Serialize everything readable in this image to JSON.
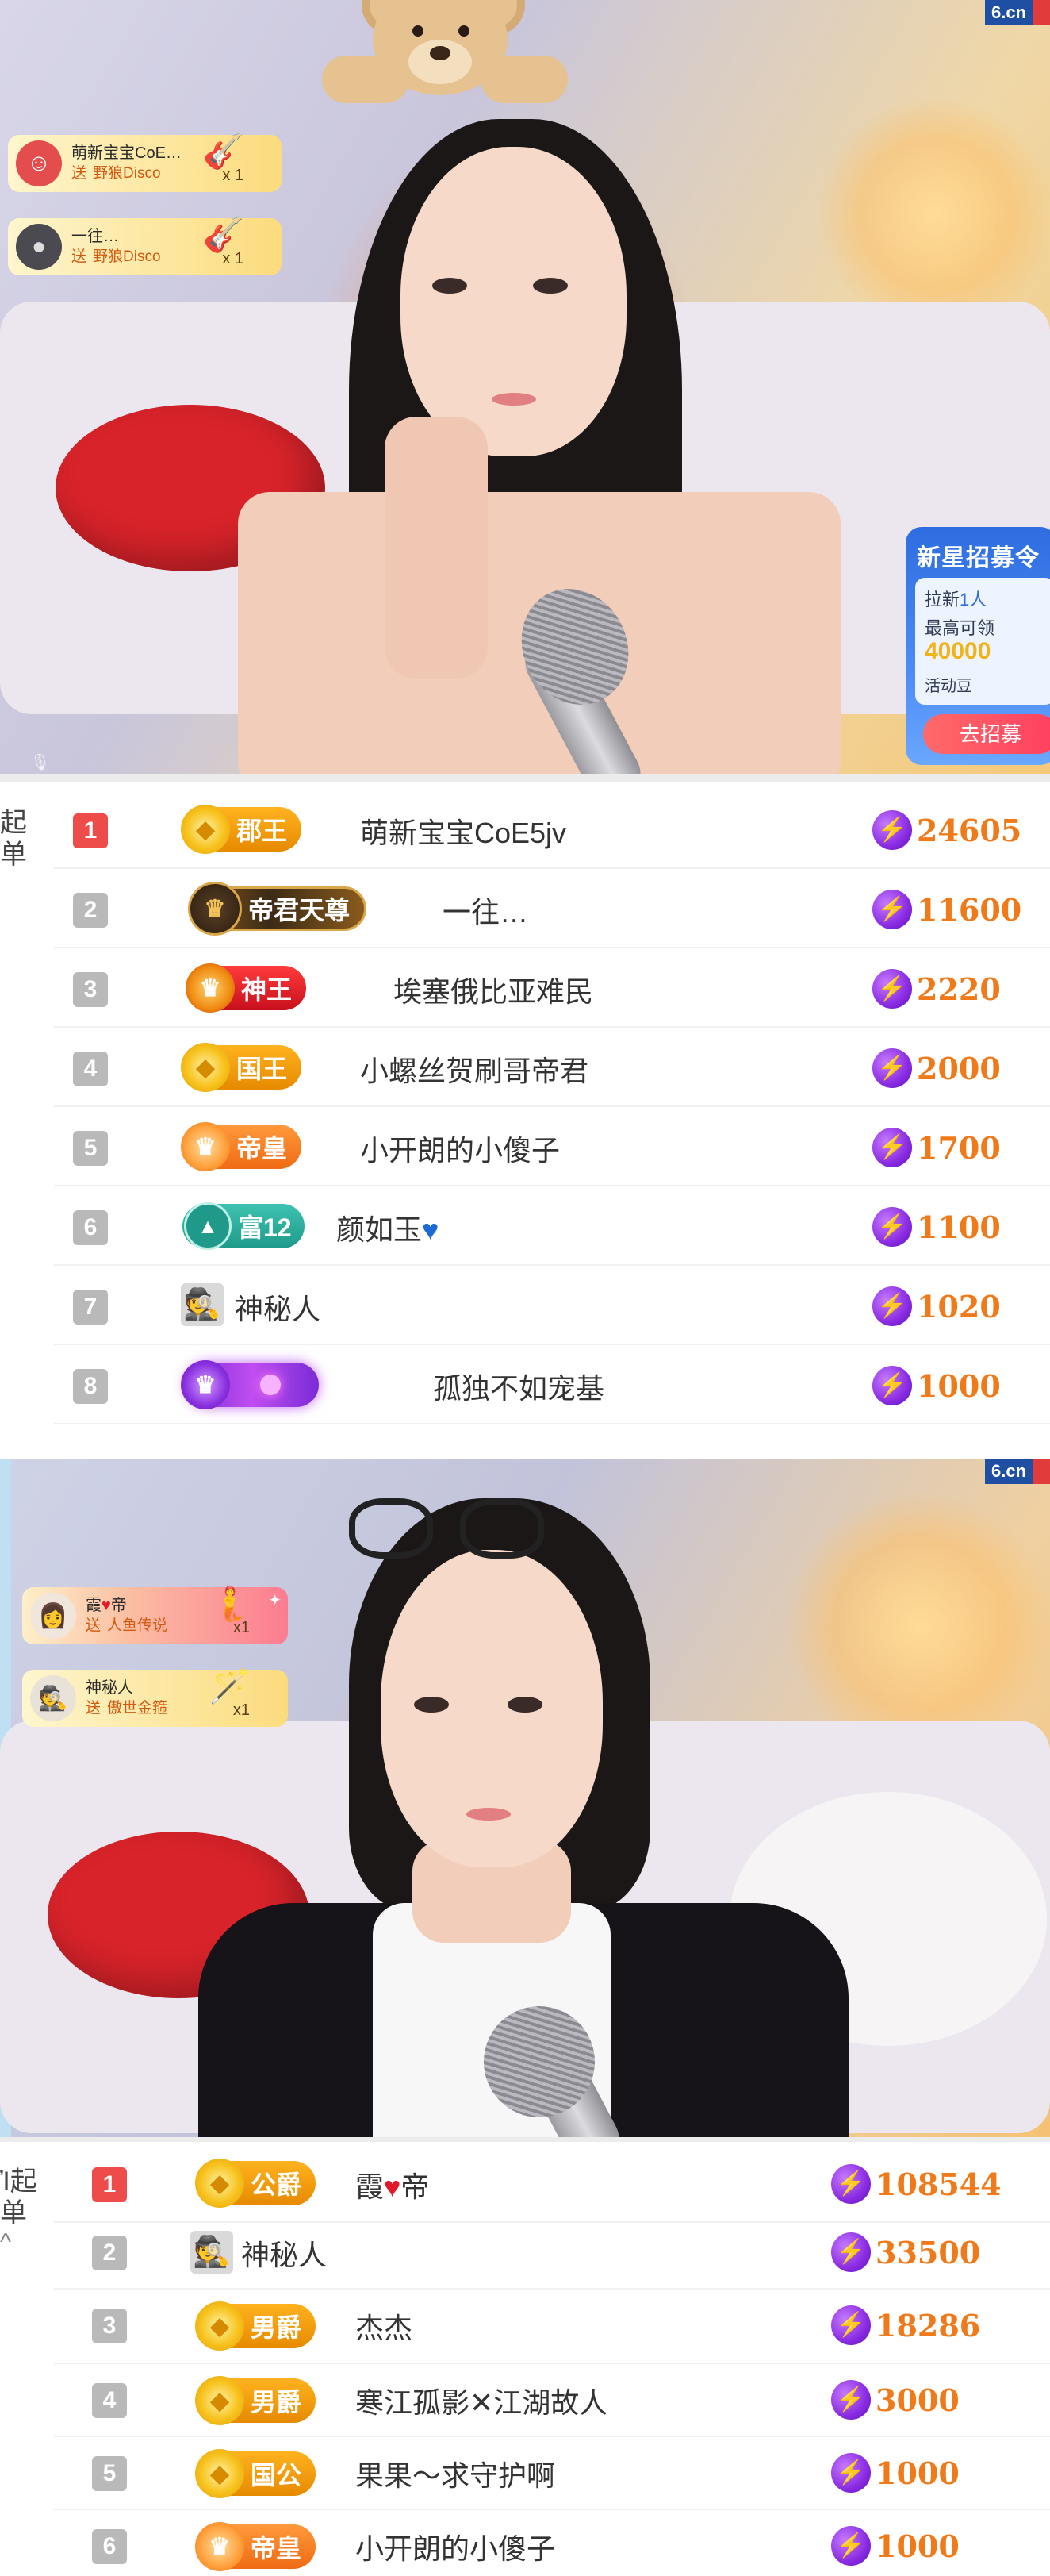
{
  "stream1": {
    "logo": "6.cn",
    "gift_notices": [
      {
        "name": "萌新宝宝CoE…",
        "send": "送",
        "gift": "野狼Disco",
        "count": "x 1"
      },
      {
        "name": "一往…",
        "send": "送",
        "gift": "野狼Disco",
        "count": "x 1"
      }
    ],
    "promo": {
      "title": "新星招募令",
      "line1_prefix": "拉新",
      "line1_highlight": "1人",
      "line2": "最高可领",
      "amount": "40000",
      "line4": "活动豆",
      "button": "去招募"
    }
  },
  "rank1": {
    "side_label": [
      "起",
      "单"
    ],
    "rows": [
      {
        "rank": "1",
        "badge": "郡王",
        "badge_style": "gold",
        "name": "萌新宝宝CoE5jv",
        "score": "24605"
      },
      {
        "rank": "2",
        "badge": "帝君天尊",
        "badge_style": "dark",
        "name": "一往…",
        "score": "11600"
      },
      {
        "rank": "3",
        "badge": "神王",
        "badge_style": "red",
        "name": "埃塞俄比亚难民",
        "score": "2220"
      },
      {
        "rank": "4",
        "badge": "国王",
        "badge_style": "gold",
        "name": "小螺丝贺刷哥帝君",
        "score": "2000"
      },
      {
        "rank": "5",
        "badge": "帝皇",
        "badge_style": "orange",
        "name": "小开朗的小傻子",
        "score": "1700"
      },
      {
        "rank": "6",
        "badge": "富12",
        "badge_style": "teal",
        "name": "颜如玉",
        "score": "1100"
      },
      {
        "rank": "7",
        "badge": "",
        "badge_style": "mystery",
        "name": "神秘人",
        "score": "1020"
      },
      {
        "rank": "8",
        "badge": "",
        "badge_style": "purple",
        "name": "孤独不如宠基",
        "score": "1000"
      }
    ]
  },
  "stream2": {
    "logo": "6.cn",
    "gift_notices": [
      {
        "name": "霞",
        "name_suffix": "帝",
        "send": "送",
        "gift": "人鱼传说",
        "count": "x1"
      },
      {
        "name": "神秘人",
        "send": "送",
        "gift": "傲世金箍",
        "count": "x1"
      }
    ]
  },
  "rank2": {
    "side_label": [
      "Ἰ起",
      "单"
    ],
    "rows": [
      {
        "rank": "1",
        "badge": "公爵",
        "badge_style": "gold",
        "name": "霞",
        "name_suffix": "帝",
        "score": "108544"
      },
      {
        "rank": "2",
        "badge": "",
        "badge_style": "mystery",
        "name": "神秘人",
        "score": "33500"
      },
      {
        "rank": "3",
        "badge": "男爵",
        "badge_style": "gold",
        "name": "杰杰",
        "score": "18286"
      },
      {
        "rank": "4",
        "badge": "男爵",
        "badge_style": "gold",
        "name": "寒江孤影",
        "name_suffix": "江湖故人",
        "score": "3000"
      },
      {
        "rank": "5",
        "badge": "国公",
        "badge_style": "gold",
        "name": "果果～求守护啊",
        "score": "1000"
      },
      {
        "rank": "6",
        "badge": "帝皇",
        "badge_style": "orange",
        "name": "小开朗的小傻子",
        "score": "1000"
      }
    ]
  },
  "colors": {
    "score": "#f07a1a",
    "rank_first": "#ee4b4b",
    "rank_other": "#b9b9b9",
    "bolt": "#8a2be2",
    "promo_blue": "#2e6de0"
  },
  "icons": {
    "bolt": "lightning-icon",
    "mystery": "mystery-person-icon",
    "mic": "microphone-icon",
    "gift": "gift-icon"
  }
}
